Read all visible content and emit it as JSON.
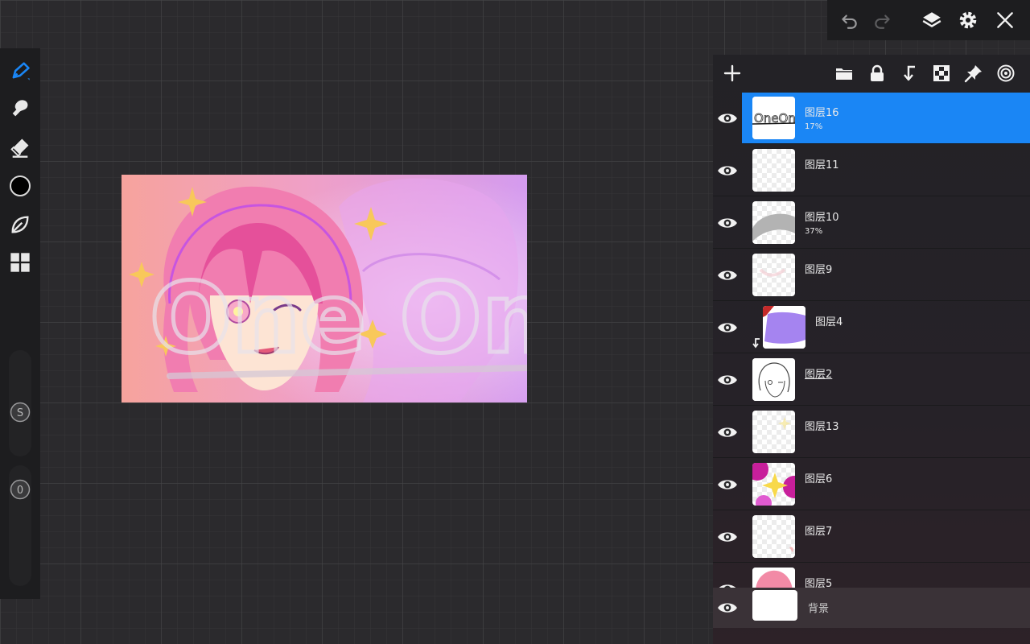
{
  "colors": {
    "accent": "#1a86f5",
    "selected_row": "#1a86f5",
    "current_brush_color": "#000000",
    "panel_bg": "#232226",
    "toolbar_bg": "#1d1d1f"
  },
  "top_toolbar": {
    "icons": [
      "undo-icon",
      "redo-icon",
      "layers-icon",
      "settings-icon",
      "close-icon"
    ]
  },
  "left_toolbar": {
    "icons": [
      "pen-icon",
      "smudge-icon",
      "eraser-icon",
      "color-swatch",
      "leaf-icon",
      "grid-icon"
    ],
    "size_slider_label": "S",
    "opacity_slider_label": "0"
  },
  "layers_header": {
    "icons": [
      "add-icon",
      "folder-icon",
      "lock-icon",
      "clip-icon",
      "transparency-icon",
      "pin-icon",
      "blend-icon"
    ]
  },
  "layers": [
    {
      "name": "图层16",
      "opacity": "17%",
      "selected": true
    },
    {
      "name": "图层11",
      "opacity": ""
    },
    {
      "name": "图层10",
      "opacity": "37%"
    },
    {
      "name": "图层9",
      "opacity": ""
    },
    {
      "name": "图层4",
      "opacity": "",
      "clipped": true
    },
    {
      "name": "图层2",
      "opacity": "",
      "underlined": true
    },
    {
      "name": "图层13",
      "opacity": ""
    },
    {
      "name": "图层6",
      "opacity": ""
    },
    {
      "name": "图层7",
      "opacity": ""
    },
    {
      "name": "图层5",
      "opacity": ""
    }
  ],
  "background_layer": {
    "name": "背景"
  },
  "canvas": {
    "logo_text": "One One"
  }
}
